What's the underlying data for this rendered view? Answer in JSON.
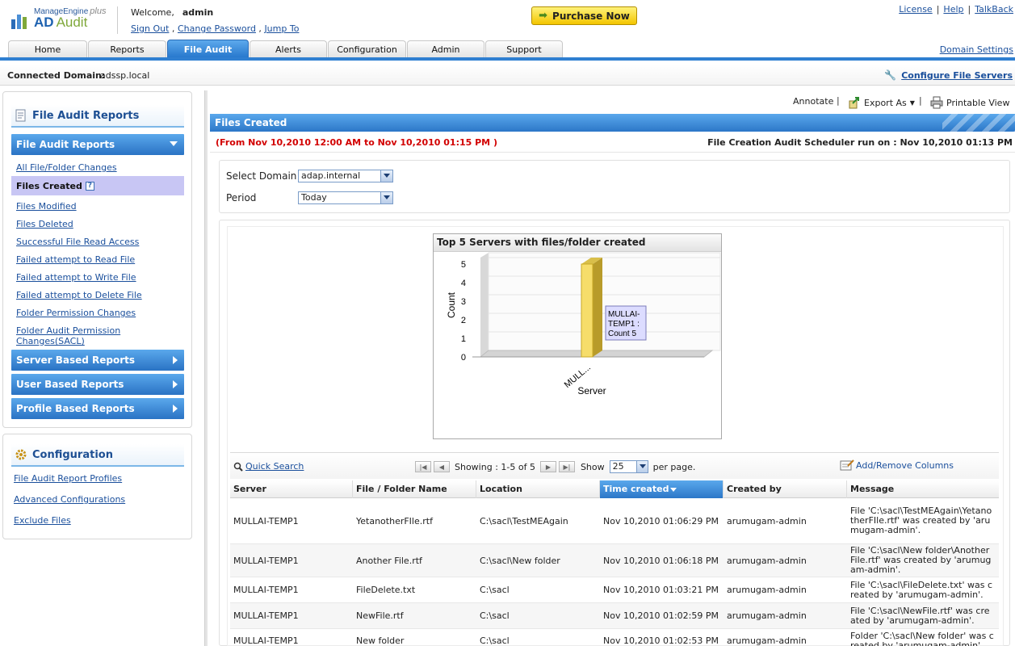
{
  "header": {
    "brand_top": "ManageEngine",
    "brand_plus": "plus",
    "product": "AD",
    "product_sub": "Audit",
    "welcome_label": "Welcome,",
    "username": "admin",
    "links": {
      "sign_out": "Sign Out",
      "change_password": "Change Password",
      "jump_to": "Jump To"
    },
    "purchase_label": "Purchase Now",
    "top_links": {
      "license": "License",
      "help": "Help",
      "talkback": "TalkBack"
    },
    "domain_settings": "Domain Settings"
  },
  "tabs": [
    {
      "label": "Home",
      "active": false
    },
    {
      "label": "Reports",
      "active": false
    },
    {
      "label": "File Audit",
      "active": true
    },
    {
      "label": "Alerts",
      "active": false
    },
    {
      "label": "Configuration",
      "active": false
    },
    {
      "label": "Admin",
      "active": false
    },
    {
      "label": "Support",
      "active": false
    }
  ],
  "connected": {
    "label": "Connected Domain:",
    "value": "adssp.local",
    "configure_label": "Configure File Servers"
  },
  "sidebar": {
    "panel_title": "File Audit Reports",
    "section_title": "File Audit Reports",
    "items": [
      "All File/Folder Changes",
      "Files Created",
      "Files Modified",
      "Files Deleted",
      "Successful File Read Access",
      "Failed attempt to Read File",
      "Failed attempt to Write File",
      "Failed attempt to Delete File",
      "Folder Permission Changes",
      "Folder Audit Permission Changes(SACL)"
    ],
    "active_item": "Files Created",
    "help_glyph": "?",
    "collapsed_sections": [
      "Server Based Reports",
      "User Based Reports",
      "Profile Based Reports"
    ],
    "config_title": "Configuration",
    "config_links": [
      "File Audit Report Profiles",
      "Advanced Configurations",
      "Exclude Files"
    ]
  },
  "toolbar": {
    "annotate": "Annotate",
    "export_as": "Export As",
    "printable_view": "Printable View"
  },
  "report": {
    "title": "Files Created",
    "date_range": "(From Nov 10,2010 12:00 AM to Nov 10,2010 01:15 PM )",
    "scheduler_run": "File Creation Audit Scheduler run on : Nov 10,2010 01:13 PM",
    "filters": {
      "domain_label": "Select Domain",
      "domain_value": "adap.internal",
      "period_label": "Period",
      "period_value": "Today"
    }
  },
  "chart_data": {
    "type": "bar",
    "title": "Top 5 Servers with files/folder created",
    "categories": [
      "MULL..."
    ],
    "values": [
      5
    ],
    "xlabel": "Server",
    "ylabel": "Count",
    "ylim": [
      0,
      5
    ],
    "yticks": [
      "0",
      "1",
      "2",
      "3",
      "4",
      "5"
    ],
    "tooltip": [
      "MULLAI-",
      "TEMP1 :",
      "Count 5"
    ],
    "bar_color": "#f6dd6a"
  },
  "grid": {
    "quick_search": "Quick Search",
    "showing": "Showing : 1-5 of 5",
    "show_label": "Show",
    "page_size": "25",
    "per_page": "per page.",
    "add_remove_columns": "Add/Remove Columns",
    "columns": [
      "Server",
      "File / Folder Name",
      "Location",
      "Time created",
      "Created by",
      "Message"
    ],
    "rows": [
      [
        "MULLAI-TEMP1",
        "YetanotherFIle.rtf",
        "C:\\sacl\\TestMEAgain",
        "Nov 10,2010 01:06:29 PM",
        "arumugam-admin",
        "File 'C:\\sacl\\TestMEAgain\\YetanotherFIle.rtf' was created by 'arumugam-admin'."
      ],
      [
        "MULLAI-TEMP1",
        "Another File.rtf",
        "C:\\sacl\\New folder",
        "Nov 10,2010 01:06:18 PM",
        "arumugam-admin",
        "File 'C:\\sacl\\New folder\\Another File.rtf' was created by 'arumugam-admin'."
      ],
      [
        "MULLAI-TEMP1",
        "FileDelete.txt",
        "C:\\sacl",
        "Nov 10,2010 01:03:21 PM",
        "arumugam-admin",
        "File 'C:\\sacl\\FileDelete.txt' was created by 'arumugam-admin'."
      ],
      [
        "MULLAI-TEMP1",
        "NewFile.rtf",
        "C:\\sacl",
        "Nov 10,2010 01:02:59 PM",
        "arumugam-admin",
        "File 'C:\\sacl\\NewFile.rtf' was created by 'arumugam-admin'."
      ],
      [
        "MULLAI-TEMP1",
        "New folder",
        "C:\\sacl",
        "Nov 10,2010 01:02:53 PM",
        "arumugam-admin",
        "Folder 'C:\\sacl\\New folder' was created by 'arumugam-admin'."
      ]
    ]
  }
}
